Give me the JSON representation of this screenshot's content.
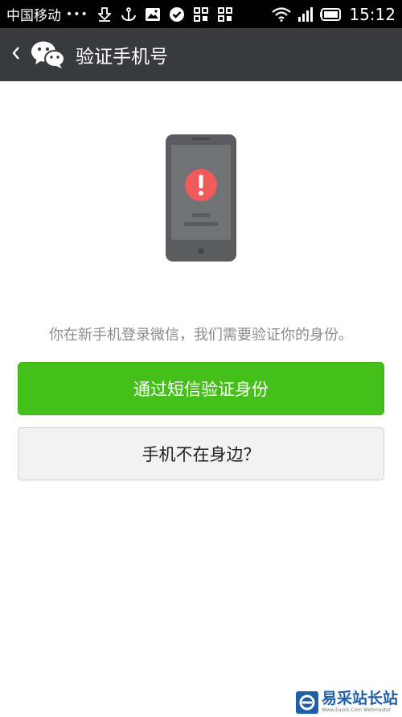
{
  "status_bar": {
    "carrier": "中国移动",
    "dots": "•••",
    "time": "15:12",
    "icons": [
      "download-icon",
      "anchor-icon",
      "image-icon",
      "check-circle-icon",
      "qr-icon",
      "qr-icon",
      "wifi-icon",
      "signal-icon",
      "battery-icon"
    ]
  },
  "header": {
    "title": "验证手机号",
    "back_icon": "chevron-left-icon",
    "logo_icon": "wechat-logo-icon",
    "background": "#393a3f"
  },
  "main": {
    "illustration": "phone-alert-icon",
    "alert_color": "#f05a5a",
    "prompt": "你在新手机登录微信，我们需要验证你的身份。",
    "primary_button": "通过短信验证身份",
    "secondary_button": "手机不在身边？",
    "primary_color": "#45c01a"
  },
  "watermark": {
    "main": "易采站长站",
    "sub": "Www.Easck.Com Webmaster"
  }
}
